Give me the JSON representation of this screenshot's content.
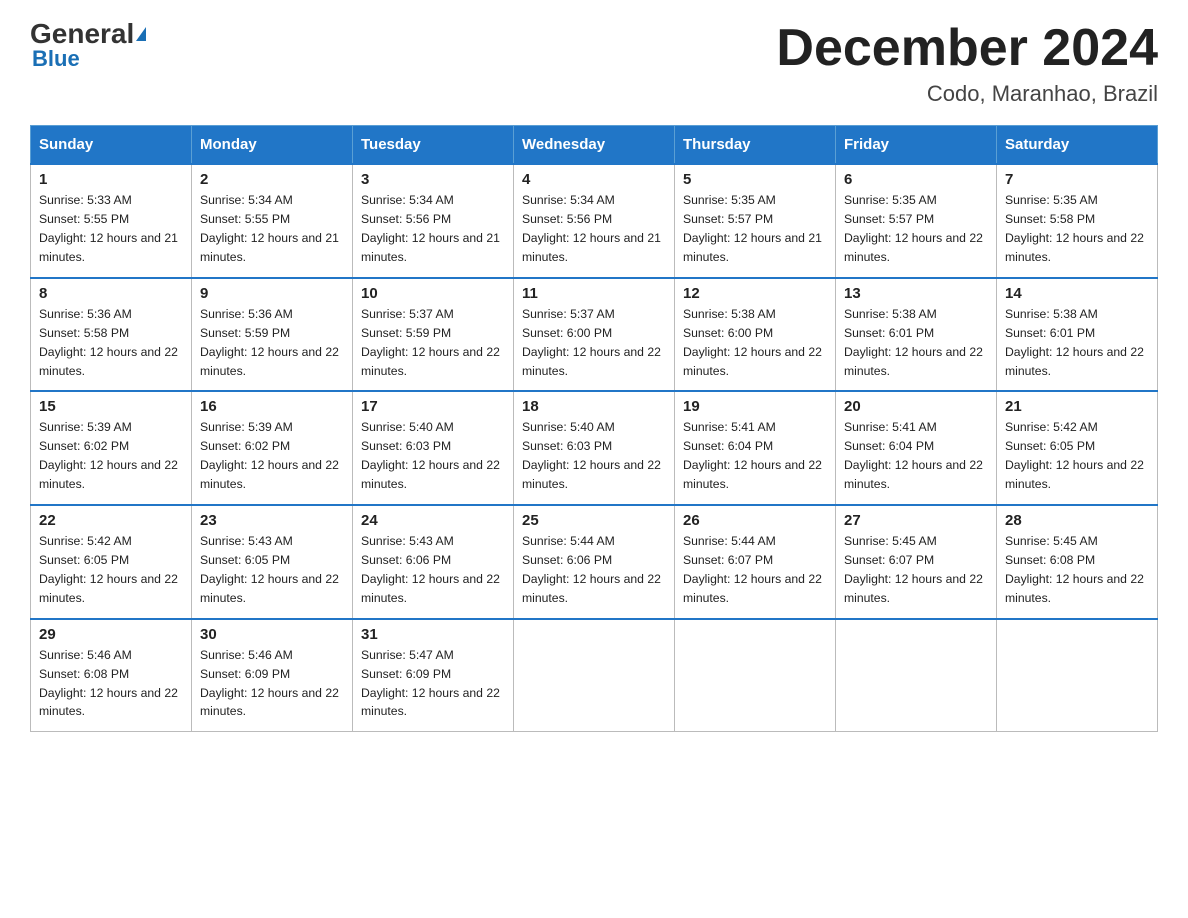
{
  "logo": {
    "general": "General",
    "blue": "Blue"
  },
  "title": "December 2024",
  "subtitle": "Codo, Maranhao, Brazil",
  "headers": [
    "Sunday",
    "Monday",
    "Tuesday",
    "Wednesday",
    "Thursday",
    "Friday",
    "Saturday"
  ],
  "weeks": [
    [
      {
        "day": "1",
        "sunrise": "5:33 AM",
        "sunset": "5:55 PM",
        "daylight": "12 hours and 21 minutes."
      },
      {
        "day": "2",
        "sunrise": "5:34 AM",
        "sunset": "5:55 PM",
        "daylight": "12 hours and 21 minutes."
      },
      {
        "day": "3",
        "sunrise": "5:34 AM",
        "sunset": "5:56 PM",
        "daylight": "12 hours and 21 minutes."
      },
      {
        "day": "4",
        "sunrise": "5:34 AM",
        "sunset": "5:56 PM",
        "daylight": "12 hours and 21 minutes."
      },
      {
        "day": "5",
        "sunrise": "5:35 AM",
        "sunset": "5:57 PM",
        "daylight": "12 hours and 21 minutes."
      },
      {
        "day": "6",
        "sunrise": "5:35 AM",
        "sunset": "5:57 PM",
        "daylight": "12 hours and 22 minutes."
      },
      {
        "day": "7",
        "sunrise": "5:35 AM",
        "sunset": "5:58 PM",
        "daylight": "12 hours and 22 minutes."
      }
    ],
    [
      {
        "day": "8",
        "sunrise": "5:36 AM",
        "sunset": "5:58 PM",
        "daylight": "12 hours and 22 minutes."
      },
      {
        "day": "9",
        "sunrise": "5:36 AM",
        "sunset": "5:59 PM",
        "daylight": "12 hours and 22 minutes."
      },
      {
        "day": "10",
        "sunrise": "5:37 AM",
        "sunset": "5:59 PM",
        "daylight": "12 hours and 22 minutes."
      },
      {
        "day": "11",
        "sunrise": "5:37 AM",
        "sunset": "6:00 PM",
        "daylight": "12 hours and 22 minutes."
      },
      {
        "day": "12",
        "sunrise": "5:38 AM",
        "sunset": "6:00 PM",
        "daylight": "12 hours and 22 minutes."
      },
      {
        "day": "13",
        "sunrise": "5:38 AM",
        "sunset": "6:01 PM",
        "daylight": "12 hours and 22 minutes."
      },
      {
        "day": "14",
        "sunrise": "5:38 AM",
        "sunset": "6:01 PM",
        "daylight": "12 hours and 22 minutes."
      }
    ],
    [
      {
        "day": "15",
        "sunrise": "5:39 AM",
        "sunset": "6:02 PM",
        "daylight": "12 hours and 22 minutes."
      },
      {
        "day": "16",
        "sunrise": "5:39 AM",
        "sunset": "6:02 PM",
        "daylight": "12 hours and 22 minutes."
      },
      {
        "day": "17",
        "sunrise": "5:40 AM",
        "sunset": "6:03 PM",
        "daylight": "12 hours and 22 minutes."
      },
      {
        "day": "18",
        "sunrise": "5:40 AM",
        "sunset": "6:03 PM",
        "daylight": "12 hours and 22 minutes."
      },
      {
        "day": "19",
        "sunrise": "5:41 AM",
        "sunset": "6:04 PM",
        "daylight": "12 hours and 22 minutes."
      },
      {
        "day": "20",
        "sunrise": "5:41 AM",
        "sunset": "6:04 PM",
        "daylight": "12 hours and 22 minutes."
      },
      {
        "day": "21",
        "sunrise": "5:42 AM",
        "sunset": "6:05 PM",
        "daylight": "12 hours and 22 minutes."
      }
    ],
    [
      {
        "day": "22",
        "sunrise": "5:42 AM",
        "sunset": "6:05 PM",
        "daylight": "12 hours and 22 minutes."
      },
      {
        "day": "23",
        "sunrise": "5:43 AM",
        "sunset": "6:05 PM",
        "daylight": "12 hours and 22 minutes."
      },
      {
        "day": "24",
        "sunrise": "5:43 AM",
        "sunset": "6:06 PM",
        "daylight": "12 hours and 22 minutes."
      },
      {
        "day": "25",
        "sunrise": "5:44 AM",
        "sunset": "6:06 PM",
        "daylight": "12 hours and 22 minutes."
      },
      {
        "day": "26",
        "sunrise": "5:44 AM",
        "sunset": "6:07 PM",
        "daylight": "12 hours and 22 minutes."
      },
      {
        "day": "27",
        "sunrise": "5:45 AM",
        "sunset": "6:07 PM",
        "daylight": "12 hours and 22 minutes."
      },
      {
        "day": "28",
        "sunrise": "5:45 AM",
        "sunset": "6:08 PM",
        "daylight": "12 hours and 22 minutes."
      }
    ],
    [
      {
        "day": "29",
        "sunrise": "5:46 AM",
        "sunset": "6:08 PM",
        "daylight": "12 hours and 22 minutes."
      },
      {
        "day": "30",
        "sunrise": "5:46 AM",
        "sunset": "6:09 PM",
        "daylight": "12 hours and 22 minutes."
      },
      {
        "day": "31",
        "sunrise": "5:47 AM",
        "sunset": "6:09 PM",
        "daylight": "12 hours and 22 minutes."
      },
      null,
      null,
      null,
      null
    ]
  ]
}
